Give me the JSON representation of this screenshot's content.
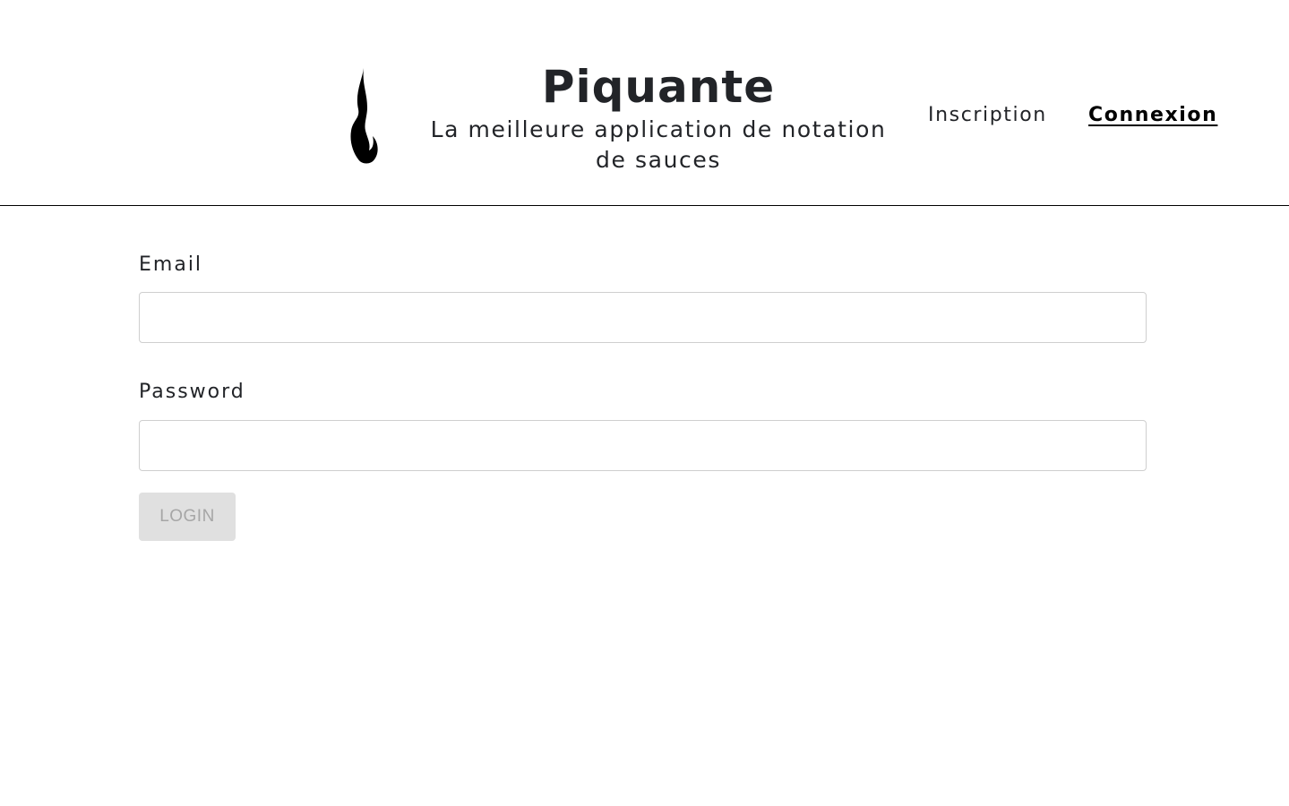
{
  "header": {
    "logo_icon": "flame-icon",
    "title": "Piquante",
    "subtitle": "La meilleure application de notation de sauces",
    "nav": {
      "signup_label": "Inscription",
      "login_label": "Connexion"
    }
  },
  "form": {
    "email_label": "Email",
    "email_value": "",
    "password_label": "Password",
    "password_value": "",
    "login_button_label": "LOGIN",
    "login_button_disabled": true
  },
  "colors": {
    "text": "#222428",
    "active_nav": "#000000",
    "divider": "#000000",
    "input_border": "#cfcfcf",
    "button_disabled_bg": "#e0e0e0",
    "button_disabled_text": "#a6a6a6"
  }
}
